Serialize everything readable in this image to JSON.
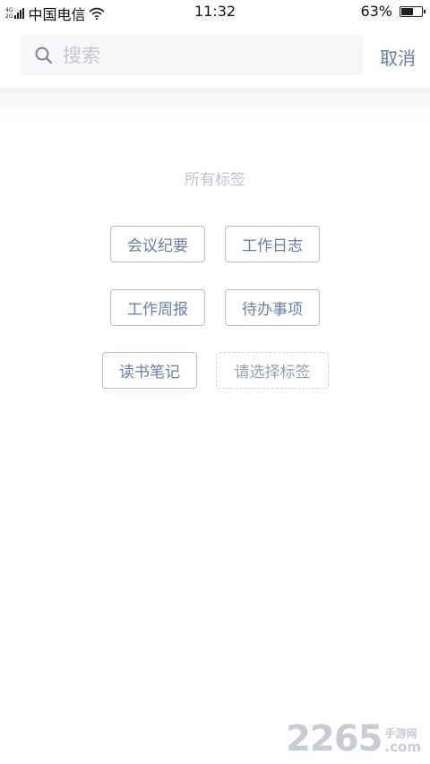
{
  "status_bar": {
    "net_top": "4G",
    "net_bottom": "2G",
    "carrier": "中国电信",
    "time": "11:32",
    "battery": "63%",
    "battery_level": 0.63
  },
  "search": {
    "placeholder": "搜索",
    "value": "",
    "cancel_label": "取消"
  },
  "tags": {
    "title": "所有标签",
    "items": [
      "会议纪要",
      "工作日志",
      "工作周报",
      "待办事项",
      "读书笔记"
    ],
    "add_placeholder": "请选择标签"
  },
  "watermark": {
    "logo": "2265",
    "site_cn": "手游网",
    "site_suffix": ".com"
  },
  "colors": {
    "accent": "#6b7fa3",
    "tag_border": "#b7c0d3",
    "muted_text": "#c2c5cc",
    "search_bg": "#f7f7f9"
  }
}
